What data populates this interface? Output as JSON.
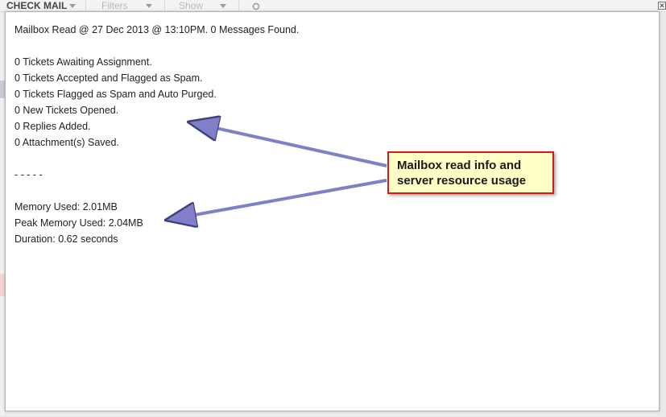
{
  "toolbar": {
    "check_mail_label": "CHECK MAIL",
    "filters_label": "Filters",
    "show_label": "Show"
  },
  "dialog": {
    "close_glyph": "✕"
  },
  "log": {
    "lines": [
      "Mailbox Read @ 27 Dec 2013 @ 13:10PM. 0 Messages Found.",
      "",
      "0 Tickets Awaiting Assignment.",
      "0 Tickets Accepted and Flagged as Spam.",
      "0 Tickets Flagged as Spam and Auto Purged.",
      "0 New Tickets Opened.",
      "0 Replies Added.",
      "0 Attachment(s) Saved.",
      "",
      "- - - - -",
      "",
      "Memory Used: 2.01MB",
      "Peak Memory Used: 2.04MB",
      "Duration: 0.62 seconds"
    ]
  },
  "callout": {
    "line1": "Mailbox read info and",
    "line2": "server resource usage",
    "border_color": "#d61a1a",
    "fill_color": "#ffffc6",
    "arrow_color": "#7f80c8"
  }
}
